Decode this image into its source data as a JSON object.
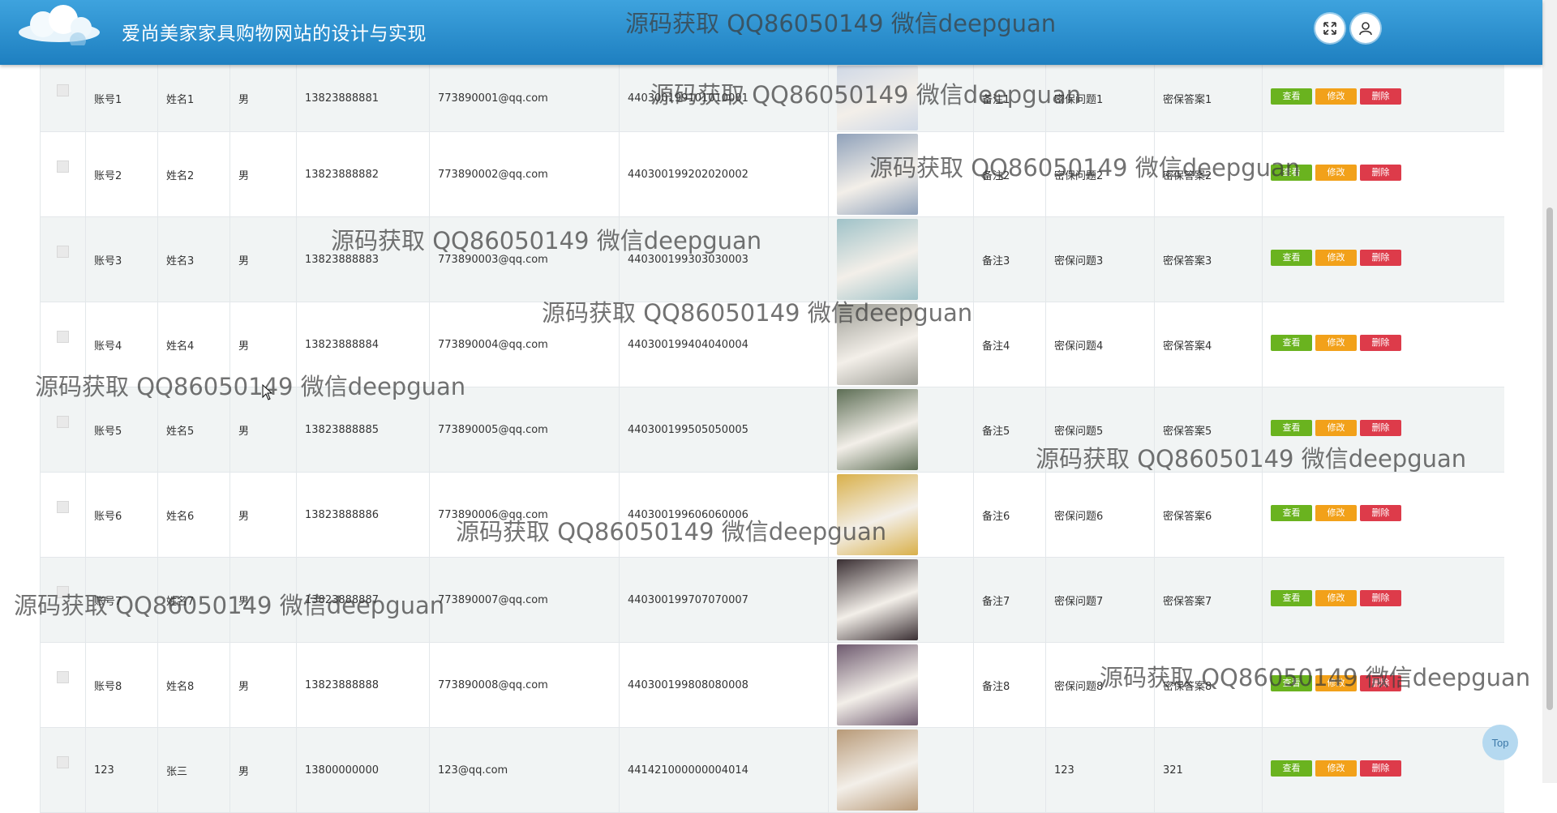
{
  "header": {
    "title": "爱尚美家家具购物网站的设计与实现"
  },
  "watermark_text": "源码获取 QQ86050149 微信deepguan",
  "actions": {
    "view": "查看",
    "edit": "修改",
    "delete": "删除"
  },
  "rows": [
    {
      "account": "账号1",
      "name": "姓名1",
      "gender": "男",
      "phone": "13823888881",
      "email": "773890001@qq.com",
      "id_card": "440300199101010001",
      "remark": "备注1",
      "question": "密保问题1",
      "answer": "密保答案1",
      "photo": "#cfd8e6"
    },
    {
      "account": "账号2",
      "name": "姓名2",
      "gender": "男",
      "phone": "13823888882",
      "email": "773890002@qq.com",
      "id_card": "440300199202020002",
      "remark": "备注2",
      "question": "密保问题2",
      "answer": "密保答案2",
      "photo": "#8fa1ba"
    },
    {
      "account": "账号3",
      "name": "姓名3",
      "gender": "男",
      "phone": "13823888883",
      "email": "773890003@qq.com",
      "id_card": "440300199303030003",
      "remark": "备注3",
      "question": "密保问题3",
      "answer": "密保答案3",
      "photo": "#9fc2c8"
    },
    {
      "account": "账号4",
      "name": "姓名4",
      "gender": "男",
      "phone": "13823888884",
      "email": "773890004@qq.com",
      "id_card": "440300199404040004",
      "remark": "备注4",
      "question": "密保问题4",
      "answer": "密保答案4",
      "photo": "#9d9d95"
    },
    {
      "account": "账号5",
      "name": "姓名5",
      "gender": "男",
      "phone": "13823888885",
      "email": "773890005@qq.com",
      "id_card": "440300199505050005",
      "remark": "备注5",
      "question": "密保问题5",
      "answer": "密保答案5",
      "photo": "#5d6e55"
    },
    {
      "account": "账号6",
      "name": "姓名6",
      "gender": "男",
      "phone": "13823888886",
      "email": "773890006@qq.com",
      "id_card": "440300199606060006",
      "remark": "备注6",
      "question": "密保问题6",
      "answer": "密保答案6",
      "photo": "#d9b04a"
    },
    {
      "account": "账号7",
      "name": "姓名7",
      "gender": "男",
      "phone": "13823888887",
      "email": "773890007@qq.com",
      "id_card": "440300199707070007",
      "remark": "备注7",
      "question": "密保问题7",
      "answer": "密保答案7",
      "photo": "#3a2f33"
    },
    {
      "account": "账号8",
      "name": "姓名8",
      "gender": "男",
      "phone": "13823888888",
      "email": "773890008@qq.com",
      "id_card": "440300199808080008",
      "remark": "备注8",
      "question": "密保问题8",
      "answer": "密保答案8",
      "photo": "#6e5a6f"
    },
    {
      "account": "123",
      "name": "张三",
      "gender": "男",
      "phone": "13800000000",
      "email": "123@qq.com",
      "id_card": "441421000000004014",
      "remark": "",
      "question": "123",
      "answer": "321",
      "photo": "#b89a78"
    }
  ],
  "top_button": "Top",
  "colors": {
    "header_top": "#3ea3de",
    "header_bottom": "#1e7fc0",
    "btn_view": "#6ab31f",
    "btn_edit": "#f2a11a",
    "btn_delete": "#dd3b4a"
  }
}
